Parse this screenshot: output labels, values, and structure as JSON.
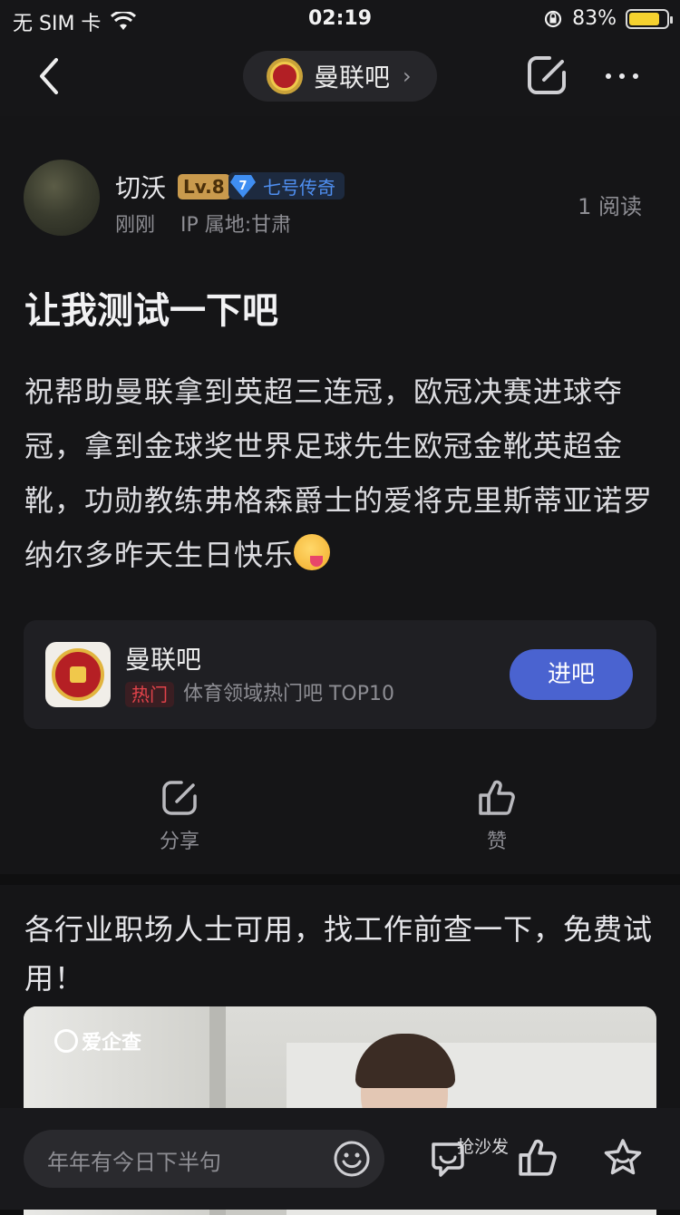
{
  "status_bar": {
    "carrier": "无 SIM 卡",
    "time": "02:19",
    "battery_percent": "83%",
    "battery_level": 0.83,
    "battery_color": "#f5d22f"
  },
  "nav": {
    "forum_title": "曼联吧",
    "back_icon": "chevron-left-icon",
    "share_icon": "share-icon",
    "more_icon": "more-icon"
  },
  "post": {
    "author": "切沃",
    "level": "Lv.8",
    "honor_rank": "7",
    "honor_title": "七号传奇",
    "time": "刚刚",
    "ip_location": "IP 属地:甘肃",
    "read_count": "1 阅读",
    "title": "让我测试一下吧",
    "body": "祝帮助曼联拿到英超三连冠，欧冠决赛进球夺冠，拿到金球奖世界足球先生欧冠金靴英超金靴，功勋教练弗格森爵士的爱将克里斯蒂亚诺罗纳尔多昨天生日快乐"
  },
  "forum_card": {
    "name": "曼联吧",
    "hot_tag": "热门",
    "subtitle": "体育领域热门吧 TOP10",
    "enter_label": "进吧",
    "accent": "#4a63d0"
  },
  "actions": {
    "share_label": "分享",
    "like_label": "赞"
  },
  "ad": {
    "text": "各行业职场人士可用，找工作前查一下，免费试用！",
    "brand": "爱企查"
  },
  "bottom_bar": {
    "comment_placeholder": "年年有今日下半句",
    "sofa_label": "抢沙发"
  }
}
